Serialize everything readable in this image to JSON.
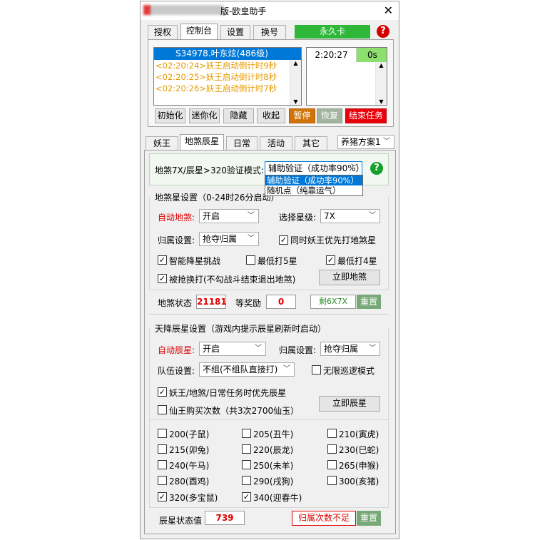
{
  "window": {
    "title_suffix": "版-欧皇助手"
  },
  "top_tabs": [
    "授权",
    "控制台",
    "设置",
    "换号"
  ],
  "license_label": "永久卡",
  "log": {
    "selected": "S34978.叶东炫(486级)",
    "lines": [
      "<02:20:24>妖王启动倒计时9秒",
      "<02:20:25>妖王启动倒计时8秒",
      "<02:20:26>妖王启动倒计时7秒"
    ]
  },
  "timer": {
    "time": "2:20:27",
    "seconds": "0s"
  },
  "controls": [
    "初始化",
    "迷你化",
    "隐藏",
    "收起",
    "暂停",
    "恢复",
    "结束任务"
  ],
  "sub_tabs": [
    "妖王",
    "地煞辰星",
    "日常",
    "活动",
    "其它"
  ],
  "plan_select": "养猪方案1",
  "verify": {
    "label": "地煞7X/辰星>320验证模式:",
    "value": "辅助验证（成功率90%）",
    "options": [
      "辅助验证（成功率90%）",
      "随机点（纯靠运气）"
    ]
  },
  "disha": {
    "group_title": "地煞星设置（0-24时26分启动）",
    "auto_label": "自动地煞:",
    "auto_value": "开启",
    "star_label": "选择星级:",
    "star_value": "7X",
    "owner_label": "归属设置:",
    "owner_value": "抢夺归属",
    "chk_priority": "同时妖王优先打地煞星",
    "chk_smart": "智能降星挑战",
    "chk_min5": "最低打5星",
    "chk_min4": "最低打4星",
    "chk_grabbed": "被抢换打(不勾战斗结束退出地煞)",
    "btn_now": "立即地煞",
    "status_label": "地煞状态",
    "status_value": "21181",
    "reward_label": "等奖励",
    "reward_value": "0",
    "remain_value": "剩6X7X",
    "reset_label": "重置"
  },
  "chenxing": {
    "group_title": "天降辰星设置（游戏内提示辰星刷新时启动）",
    "auto_label": "自动辰星:",
    "auto_value": "开启",
    "owner_label": "归属设置:",
    "owner_value": "抢夺归属",
    "team_label": "队伍设置:",
    "team_value": "不组(不组队直接打)",
    "chk_infinite": "无限巡逻模式",
    "chk_priority": "妖王/地煞/日常任务时优先辰星",
    "chk_buy": "仙王购买次数（共3次2700仙玉）",
    "btn_now": "立即辰星",
    "levels": [
      {
        "label": "200(子鼠)",
        "checked": false
      },
      {
        "label": "205(丑牛)",
        "checked": false
      },
      {
        "label": "210(寅虎)",
        "checked": false
      },
      {
        "label": "215(卯兔)",
        "checked": false
      },
      {
        "label": "220(辰龙)",
        "checked": false
      },
      {
        "label": "230(巳蛇)",
        "checked": false
      },
      {
        "label": "240(午马)",
        "checked": false
      },
      {
        "label": "250(未羊)",
        "checked": false
      },
      {
        "label": "265(申猴)",
        "checked": false
      },
      {
        "label": "280(酉鸡)",
        "checked": false
      },
      {
        "label": "290(戌狗)",
        "checked": false
      },
      {
        "label": "300(亥猪)",
        "checked": false
      },
      {
        "label": "320(多宝鼠)",
        "checked": true
      },
      {
        "label": "340(迎春牛)",
        "checked": true
      }
    ],
    "status_label": "辰星状态值",
    "status_value": "739",
    "owner_status": "归属次数不足",
    "reset_label": "重置"
  },
  "colors": {
    "license_green": "#2fb73a",
    "selection_blue": "#0078d7",
    "log_orange": "#e69a00",
    "pause_orange": "#d2730a",
    "resume_gray": "#a2b39f",
    "end_red": "#e8000a",
    "reset_green": "#78a878",
    "help_red": "#d40000",
    "help_green": "#13a02b"
  }
}
